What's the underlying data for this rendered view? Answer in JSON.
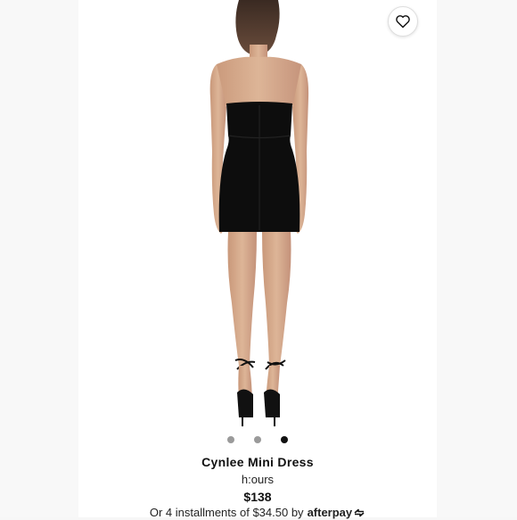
{
  "product": {
    "name": "Cynlee Mini Dress",
    "brand": "h:ours",
    "price": "$138",
    "installments_text": "Or 4 installments of $34.50 by",
    "afterpay_label": "afterpay"
  },
  "gallery": {
    "image_count": 3,
    "active_index": 2
  },
  "icons": {
    "favorite": "heart-outline-icon",
    "afterpay_logo": "afterpay-arrows-icon"
  },
  "colors": {
    "background": "#f7f7f7",
    "card": "#ffffff",
    "dress": "#0d0d0d",
    "skin": "#d6ad8e",
    "dot_active": "#111111",
    "dot_inactive": "#9a9a9a"
  }
}
